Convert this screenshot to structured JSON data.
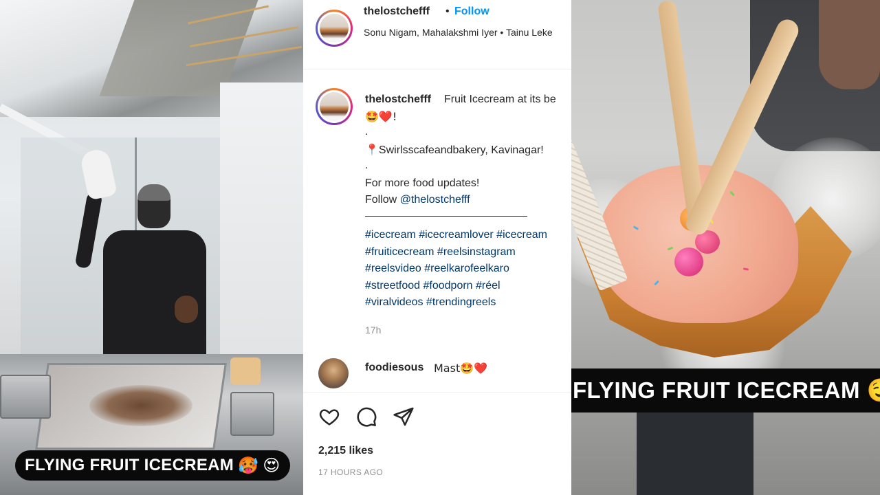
{
  "left_video": {
    "caption": "FLYING FRUIT ICECREAM",
    "caption_emojis": [
      "🥵",
      "😍"
    ]
  },
  "post": {
    "header": {
      "username": "thelostchefff",
      "separator": "•",
      "follow_label": "Follow",
      "audio_line": "Sonu Nigam, Mahalakshmi Iyer • Tainu Leke"
    },
    "caption": {
      "username": "thelostchefff",
      "title": "Fruit Icecream at its be",
      "emoji_line": "🤩❤️!",
      "dot1": ".",
      "location": "📍Swirlsscafeandbakery, Kavinagar!",
      "dot2": ".",
      "updates": "For more food updates!",
      "follow_prefix": "Follow ",
      "mention": "@thelostchefff",
      "hashtag_lines": [
        "#icecream #icecreamlover #icecream",
        "#fruiticecream #reelsinstagram",
        "#reelsvideo #reelkarofeelkaro",
        "#streetfood #foodporn #réel",
        "#viralvideos #trendingreels"
      ],
      "time_ago": "17h"
    },
    "comment": {
      "username": "foodiesous",
      "text": "Mast🤩❤️"
    },
    "actions": {
      "like_icon": "heart-outline-icon",
      "comment_icon": "comment-bubble-icon",
      "share_icon": "paper-plane-icon"
    },
    "likes": "2,215 likes",
    "posted": "17 HOURS AGO"
  },
  "right_video": {
    "caption": "FLYING FRUIT ICECREAM",
    "caption_emojis": [
      "🤤",
      "😍"
    ]
  },
  "colors": {
    "follow_blue": "#0095f6",
    "hashtag_blue": "#00376b",
    "muted_gray": "#8e8e8e"
  }
}
